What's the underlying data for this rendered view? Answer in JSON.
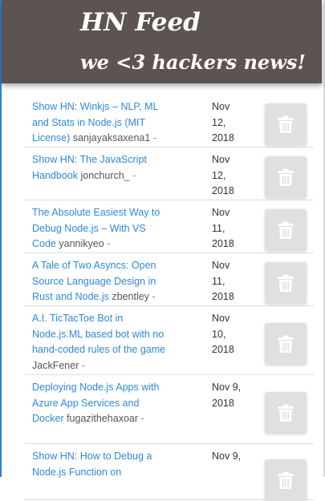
{
  "header": {
    "title": "HN Feed",
    "subtitle": "we <3 hackers news!",
    "background_color": "#5d5350"
  },
  "feed": {
    "delete_icon": "trash-icon",
    "link_color": "#2f88db",
    "items": [
      {
        "title": "Show HN: Winkjs – NLP, ML and Stats in Node.js (MIT License)",
        "author": "sanjayaksaxena1",
        "separator": "-",
        "date": "Nov 12, 2018"
      },
      {
        "title": "Show HN: The JavaScript Handbook",
        "author": "jonchurch_",
        "separator": "-",
        "date": "Nov 12, 2018"
      },
      {
        "title": "The Absolute Easiest Way to Debug Node.js – With VS Code",
        "author": "yannikyeo",
        "separator": "-",
        "date": "Nov 11, 2018"
      },
      {
        "title": "A Tale of Two Asyncs: Open Source Language Design in Rust and Node.js",
        "author": "zbentley",
        "separator": "-",
        "date": "Nov 11, 2018"
      },
      {
        "title": "A.I. TicTacToe Bot in Node.js.ML based bot with no hand-coded rules of the game",
        "author": "JackFener",
        "separator": "-",
        "date": "Nov 10, 2018"
      },
      {
        "title": "Deploying Node.js Apps with Azure App Services and Docker",
        "author": "fugazithehaxoar",
        "separator": "-",
        "date": "Nov 9, 2018"
      },
      {
        "title": "Show HN: How to Debug a Node.js Function on",
        "author": "",
        "separator": "",
        "date": "Nov 9,"
      }
    ]
  }
}
